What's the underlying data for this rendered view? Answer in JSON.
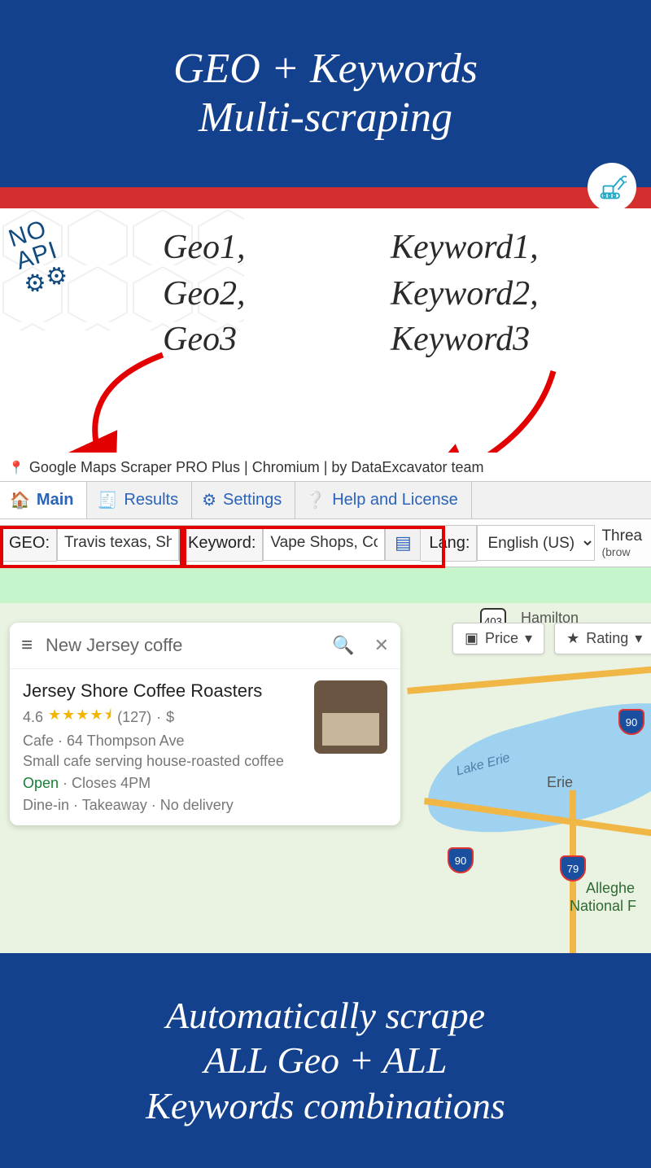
{
  "banner_top": {
    "line1": "GEO + Keywords",
    "line2": "Multi-scraping"
  },
  "noapi": {
    "line1": "NO",
    "line2": "API"
  },
  "geo_list": {
    "l1": "Geo1,",
    "l2": "Geo2,",
    "l3": "Geo3"
  },
  "kw_list": {
    "l1": "Keyword1,",
    "l2": "Keyword2,",
    "l3": "Keyword3"
  },
  "titlebar": "Google Maps Scraper PRO Plus | Chromium | by DataExcavator team",
  "tabs": {
    "main": "Main",
    "results": "Results",
    "settings": "Settings",
    "help": "Help and License"
  },
  "toolbar": {
    "geo_label": "GEO:",
    "geo_value": "Travis texas, Sh",
    "kw_label": "Keyword:",
    "kw_value": "Vape Shops, Co",
    "lang_label": "Lang:",
    "lang_value": "English (US)",
    "threads_label": "Threa",
    "threads_sub": "(brow"
  },
  "gm": {
    "search_value": "New Jersey coffe",
    "result_title": "Jersey Shore Coffee Roasters",
    "rating_value": "4.6",
    "stars": "★★★★⯨",
    "reviews": "(127)",
    "price": "$",
    "category": "Cafe",
    "address": "64 Thompson Ave",
    "desc": "Small cafe serving house-roasted coffee",
    "open": "Open",
    "closes": "Closes 4PM",
    "serve": "Dine-in · Takeaway · No delivery",
    "chip_price": "Price",
    "chip_rating": "Rating"
  },
  "map_labels": {
    "hamilton": "Hamilton",
    "erie": "Erie",
    "lake": "Lake Erie",
    "allegheny1": "Alleghe",
    "allegheny2": "National F",
    "s403": "403",
    "s90a": "90",
    "s90b": "90",
    "s79": "79"
  },
  "banner_bottom": {
    "line1": "Automatically scrape",
    "line2": "ALL Geo + ALL",
    "line3": "Keywords combinations"
  }
}
